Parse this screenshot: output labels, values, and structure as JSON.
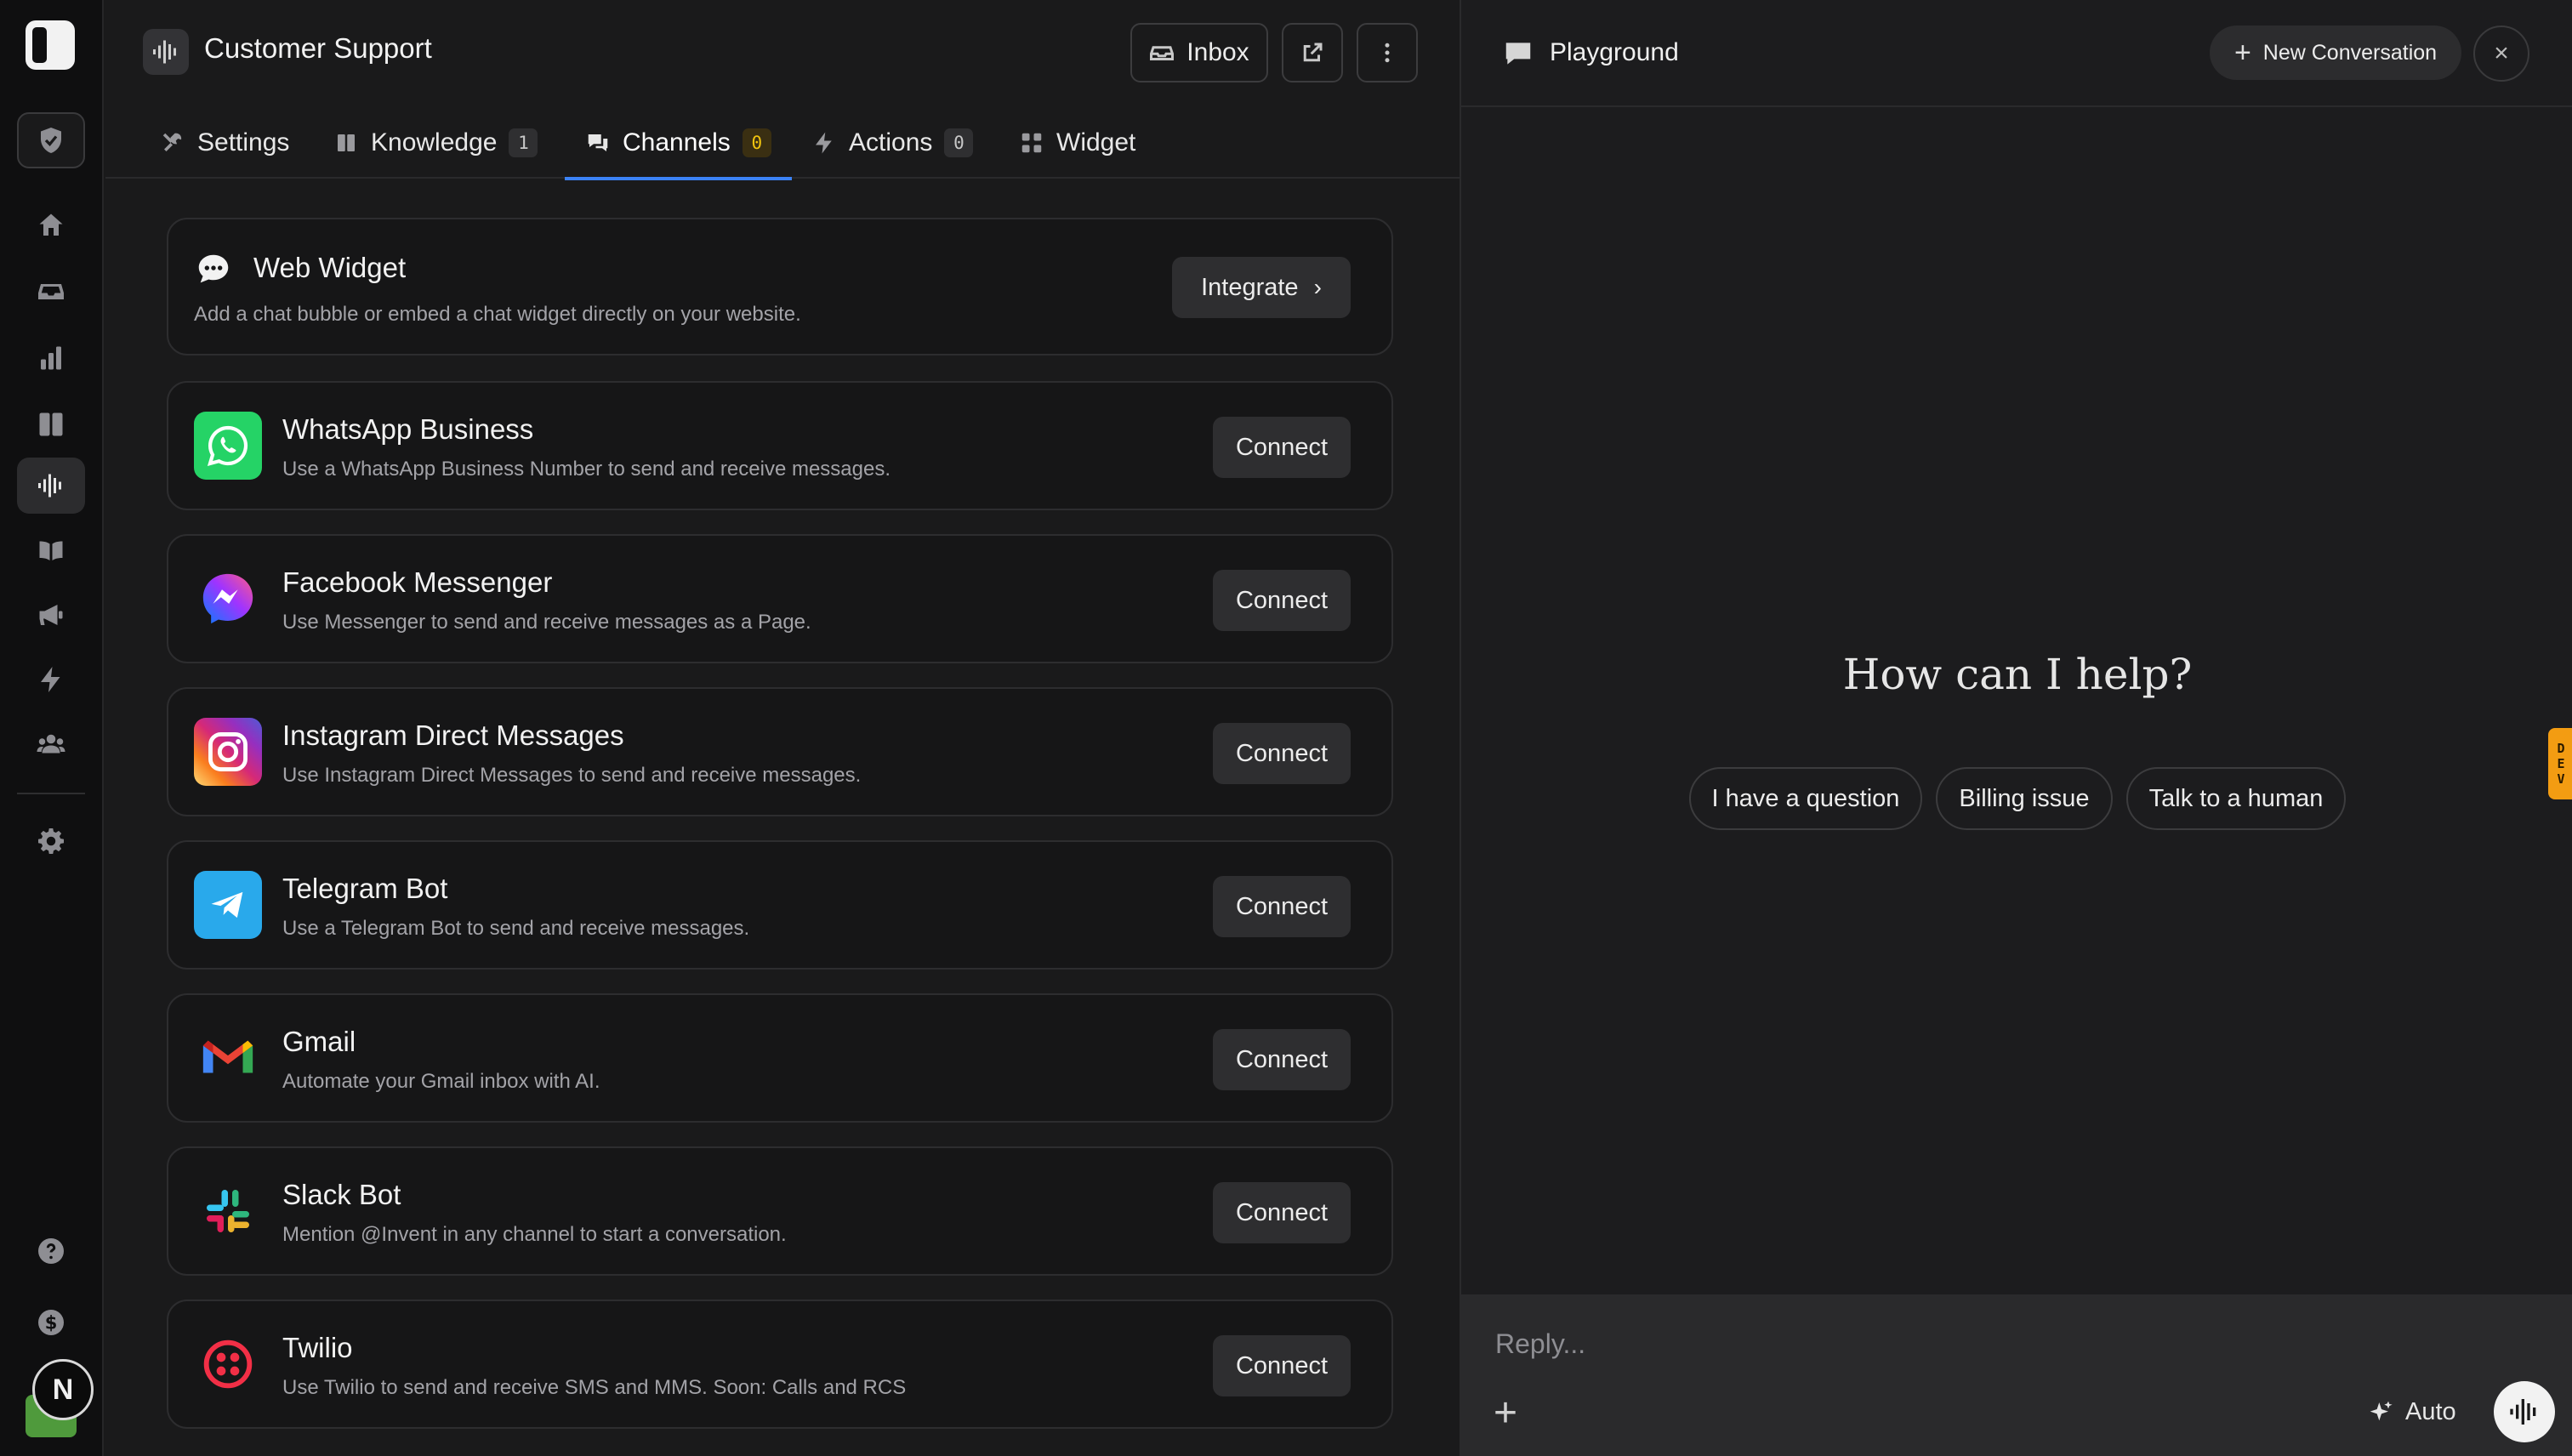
{
  "app": {
    "title": "Customer Support"
  },
  "header": {
    "inbox_label": "Inbox"
  },
  "tabs": [
    {
      "label": "Settings",
      "icon": "tools-icon"
    },
    {
      "label": "Knowledge",
      "badge": "1",
      "icon": "book-icon"
    },
    {
      "label": "Channels",
      "badge": "0",
      "icon": "chat-bubbles-icon",
      "active": true
    },
    {
      "label": "Actions",
      "badge": "0",
      "icon": "lightning-icon"
    },
    {
      "label": "Widget",
      "icon": "grid-icon"
    }
  ],
  "web_widget": {
    "title": "Web Widget",
    "description": "Add a chat bubble or embed a chat widget directly on your website.",
    "button_label": "Integrate"
  },
  "channels": [
    {
      "title": "WhatsApp Business",
      "description": "Use a WhatsApp Business Number to send and receive messages.",
      "button": "Connect",
      "icon": "whatsapp-icon",
      "color": "#25D366"
    },
    {
      "title": "Facebook Messenger",
      "description": "Use Messenger to send and receive messages as a Page.",
      "button": "Connect",
      "icon": "messenger-icon",
      "color": "#7b4dff"
    },
    {
      "title": "Instagram Direct Messages",
      "description": "Use Instagram Direct Messages to send and receive messages.",
      "button": "Connect",
      "icon": "instagram-icon",
      "color": "#e1306c"
    },
    {
      "title": "Telegram Bot",
      "description": "Use a Telegram Bot to send and receive messages.",
      "button": "Connect",
      "icon": "telegram-icon",
      "color": "#29a9eb"
    },
    {
      "title": "Gmail",
      "description": "Automate your Gmail inbox with AI.",
      "button": "Connect",
      "icon": "gmail-icon",
      "color": "#ea4335"
    },
    {
      "title": "Slack Bot",
      "description": "Mention @Invent in any channel to start a conversation.",
      "button": "Connect",
      "icon": "slack-icon",
      "color": "#4a154b"
    },
    {
      "title": "Twilio",
      "description": "Use Twilio to send and receive SMS and MMS. Soon: Calls and RCS",
      "button": "Connect",
      "icon": "twilio-icon",
      "color": "#f22f46"
    }
  ],
  "playground": {
    "title": "Playground",
    "new_conversation": "New Conversation",
    "heading": "How can I help?",
    "suggestions": [
      "I have a question",
      "Billing issue",
      "Talk to a human"
    ],
    "reply_placeholder": "Reply...",
    "mode_label": "Auto",
    "dev_tag": [
      "D",
      "E",
      "V"
    ]
  },
  "user": {
    "avatar_letter": "N"
  },
  "colors": {
    "accent": "#3b82f6",
    "badge_warn": "#f1c40f",
    "dev_tag": "#f39c12"
  }
}
